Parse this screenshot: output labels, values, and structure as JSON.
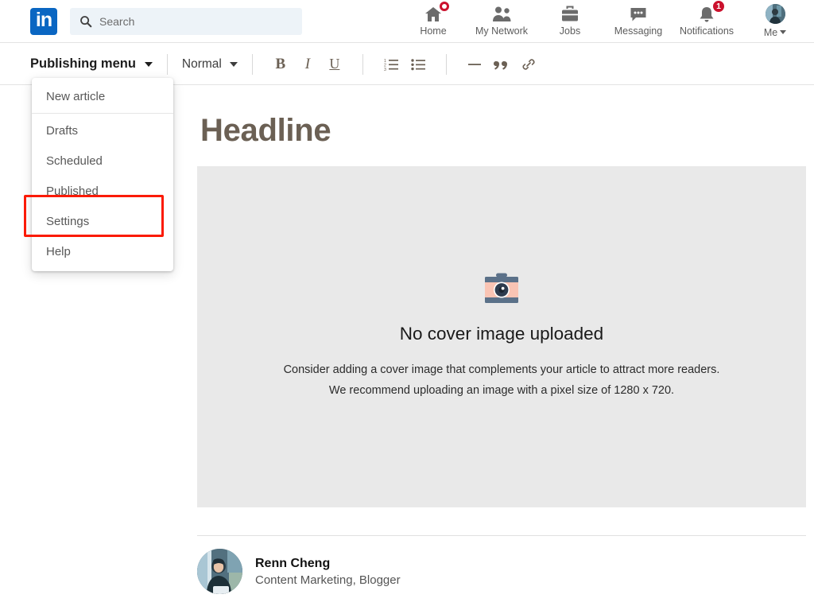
{
  "nav": {
    "logo_text": "in",
    "search": {
      "placeholder": "Search",
      "value": "",
      "icon": "search-icon"
    },
    "items": [
      {
        "label": "Home",
        "icon": "home-icon",
        "badge": "",
        "badge_type": "ring"
      },
      {
        "label": "My Network",
        "icon": "people-icon",
        "badge": "",
        "badge_type": "none"
      },
      {
        "label": "Jobs",
        "icon": "briefcase-icon",
        "badge": "",
        "badge_type": "none"
      },
      {
        "label": "Messaging",
        "icon": "message-bubble-icon",
        "badge": "",
        "badge_type": "none"
      },
      {
        "label": "Notifications",
        "icon": "bell-icon",
        "badge": "1",
        "badge_type": "number"
      }
    ],
    "me": {
      "label": "Me",
      "icon": "avatar",
      "caret": "chevron-down-icon"
    }
  },
  "toolbar": {
    "publishing_menu_label": "Publishing menu",
    "style_select_value": "Normal",
    "bold_label": "B",
    "italic_label": "I",
    "underline_label": "U",
    "buttons": [
      {
        "name": "ordered-list",
        "label": ""
      },
      {
        "name": "unordered-list",
        "label": ""
      },
      {
        "name": "divider",
        "label": ""
      },
      {
        "name": "blockquote",
        "label": ""
      },
      {
        "name": "link",
        "label": ""
      }
    ]
  },
  "dropdown": {
    "items": [
      {
        "label": "New article",
        "highlighted": false
      },
      {
        "label": "Drafts",
        "highlighted": false
      },
      {
        "label": "Scheduled",
        "highlighted": false
      },
      {
        "label": "Published",
        "highlighted": false
      },
      {
        "label": "Settings",
        "highlighted": true
      },
      {
        "label": "Help",
        "highlighted": false
      }
    ],
    "highlight_color": "#fb1a02"
  },
  "article": {
    "headline_placeholder": "Headline",
    "cover": {
      "icon": "camera-icon",
      "title": "No cover image uploaded",
      "line1": "Consider adding a cover image that complements your article to attract more readers.",
      "line2": "We recommend uploading an image with a pixel size of 1280 x 720."
    },
    "author": {
      "name": "Renn Cheng",
      "subtitle": "Content Marketing, Blogger",
      "avatar": "author-avatar"
    }
  },
  "colors": {
    "linkedin_blue": "#0a66c2",
    "badge_red": "#cb112d",
    "highlight_red": "#fb1a02",
    "cover_gray": "#e9e9e9",
    "placeholder_brown": "#6b6054"
  }
}
